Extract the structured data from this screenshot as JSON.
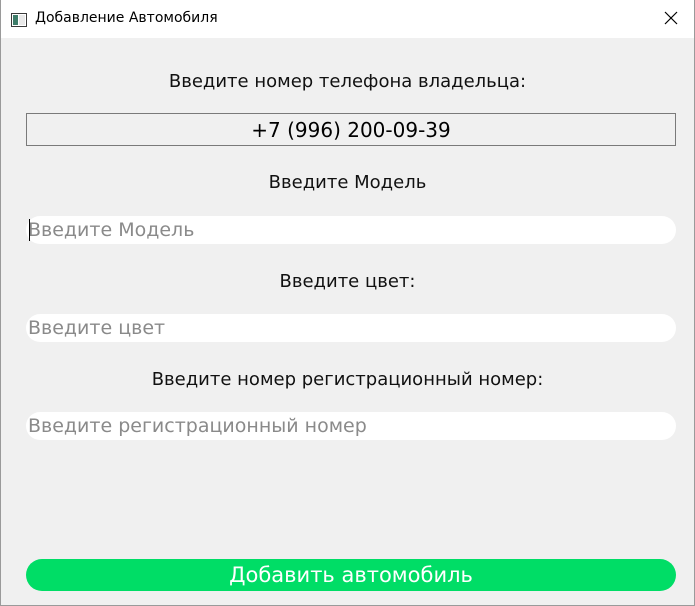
{
  "window": {
    "title": "Добавление Автомобиля",
    "app_icon": "window-icon",
    "close_icon": "close-icon"
  },
  "form": {
    "phone_label": "Введите номер телефона владельца:",
    "phone_value": "+7 (996) 200-09-39",
    "model_label": "Введите Модель",
    "model_placeholder": "Введите Модель",
    "model_value": "",
    "color_label": "Введите цвет:",
    "color_placeholder": "Введите цвет",
    "color_value": "",
    "reg_label": "Введите номер регистрационный номер:",
    "reg_placeholder": "Введите регистрационный номер",
    "reg_value": "",
    "submit_label": "Добавить автомобиль"
  },
  "colors": {
    "accent_button": "#00dd66",
    "window_bg": "#f0f0f0",
    "placeholder": "#8a8a8a"
  }
}
